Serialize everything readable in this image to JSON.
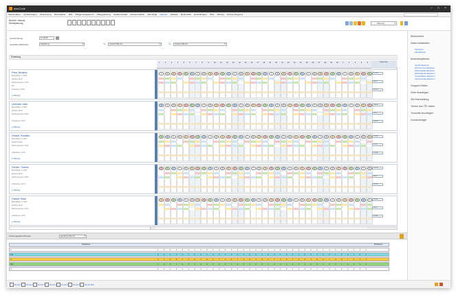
{
  "window": {
    "app_title": "awoCode",
    "controls": [
      "–",
      "□",
      "×"
    ]
  },
  "menu": [
    "Stammdaten",
    "Verordnungen",
    "Abrechnung",
    "Dienstpläne",
    "MIS",
    "Pflegemanagement",
    "Pflegeplanung",
    "Strukturmodell",
    "Dokumentation",
    "Zahnfolge",
    "Dienste",
    "Statistik",
    "Multimedia",
    "Einstellungen",
    "Hilfe",
    "Dienste",
    "Extras (Support)"
  ],
  "menu_active": "Dienste",
  "toolbar": {
    "bereich_label": "Bereich: Dienste",
    "bereich_sub": "Dienstplanung",
    "view_select": "Planung"
  },
  "filter": {
    "month_label": "Ansicht Monat",
    "month_value": "11.2016",
    "group_label": "Gewählte Mitarbeiter",
    "group_value": "Abteilung",
    "search1": "Auswertdienst",
    "search2": "Auswertdienst"
  },
  "section_title": "Einteilung",
  "sidebar": {
    "items": [
      {
        "label": "Wochentest",
        "sub": false
      },
      {
        "label": "Daten bearbeiten",
        "sub": false
      },
      {
        "label": "Speichern",
        "sub": true
      },
      {
        "label": "Aktualisieren",
        "sub": true
      },
      {
        "label": "Ansichtsoptionen",
        "sub": false
      },
      {
        "label": "Soziali aktivieren",
        "sub": true
      },
      {
        "label": "IST-Summen aktivieren",
        "sub": true
      },
      {
        "label": "Planungsfeld aktivieren",
        "sub": true
      },
      {
        "label": "Zahnfolgezeit aktivieren",
        "sub": true
      },
      {
        "label": "Kostenstellen aktivieren",
        "sub": true
      },
      {
        "label": "Summenzeile aktivieren",
        "sub": true
      },
      {
        "label": "Gruppen bilden",
        "sub": false
      },
      {
        "label": "Zeile hinzufügen",
        "sub": false
      },
      {
        "label": "ZM Überstellung",
        "sub": false
      },
      {
        "label": "Touren aus TPL laden",
        "sub": false
      },
      {
        "label": "Tourzeile hinzufügen",
        "sub": false
      },
      {
        "label": "Druckmanager",
        "sub": false
      }
    ]
  },
  "grid": {
    "summary_header": "Summen",
    "employees": [
      {
        "name": "Pieus, Michaels",
        "info": [
          "Beschäftigt: 1.1.2007",
          "Sprache 30.00",
          "Wochenstunden: 37.50",
          "IST:",
          "Abrechnen: 15:00"
        ],
        "plan": "Planung",
        "sum": [
          "151:00",
          "39:50",
          "161:30"
        ]
      },
      {
        "name": "Leutmaier, Anita",
        "info": [
          "Beschäftigt: 1.1.2007",
          "Sprache 30.00",
          "Wochenstunden: 38.50",
          "",
          "Urlaubsrest: 15:00"
        ],
        "plan": "Planung",
        "sum": [
          "138:00",
          "35:00",
          "149:30"
        ]
      },
      {
        "name": "Erlhardt, Roswitha",
        "info": [
          "Beschäftigt: 1.1.2007",
          "Sprache 30.00",
          "Wochenstunden: 30.00",
          "",
          "Urlaubsrest: 12:00"
        ],
        "plan": "Planung",
        "sum": [
          "122:00",
          "31:00",
          "128:00"
        ]
      },
      {
        "name": "Fischerr, Thomas",
        "info": [
          "Beschäftigt: 1.1.2007",
          "Sprache 30.00",
          "Wochenstunden: 38.50",
          "",
          "Urlaubsrest: 10:00"
        ],
        "plan": "Planung",
        "sum": [
          "162:00",
          "38:00",
          "176:00"
        ]
      },
      {
        "name": "Frikardt, Rosia",
        "info": [
          "Beschäftigt: 1.1.2007",
          "Sprache 30.00",
          "Wochenstunden: 30.00",
          "",
          "Urlaubsrest: 12:00"
        ],
        "plan": "Planung",
        "sum": [
          "128:00",
          "32:00",
          "134:00"
        ]
      }
    ]
  },
  "bottom": {
    "label": "Anzeit geplante Dienste",
    "select": "geplante Dienst",
    "head_left": "Mitarbeiter",
    "head_right": "Mitarbeiter",
    "rows": [
      {
        "label": "F",
        "color": "#ffffff"
      },
      {
        "label": "F/D",
        "color": "#7fd7e0"
      },
      {
        "label": "S",
        "color": "#f5c842"
      },
      {
        "label": "S/D",
        "color": "#8fd67a"
      },
      {
        "label": "N",
        "color": "#ffffff"
      }
    ]
  },
  "statusbar": [
    "Druck Alle",
    "Druck Alle",
    "Druck Alle",
    "Druck Alle",
    "Druck Alle",
    "Druck Alle",
    "Druck Alle"
  ],
  "colors": {
    "accent": "#2a6ad1",
    "title_bg": "#2e2e2e",
    "early": "#f6c7c7",
    "late": "#c8e6b0",
    "free": "#ffffff"
  }
}
